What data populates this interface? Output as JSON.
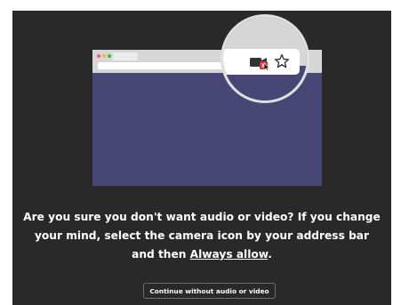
{
  "message": {
    "line1": "Are you sure you don't want audio or video? If you change",
    "line2": "your mind, select the camera icon by your address bar",
    "line3_prefix": "and then ",
    "line3_link": "Always allow",
    "line3_suffix": "."
  },
  "buttons": {
    "continue_label": "Continue without audio or video"
  },
  "icons": {
    "camera": "camera-blocked-icon",
    "star": "star-icon",
    "cursor": "cursor-icon"
  },
  "colors": {
    "dialog_background": "#292929",
    "browser_content": "#464775",
    "blocked_badge": "#d13438"
  }
}
